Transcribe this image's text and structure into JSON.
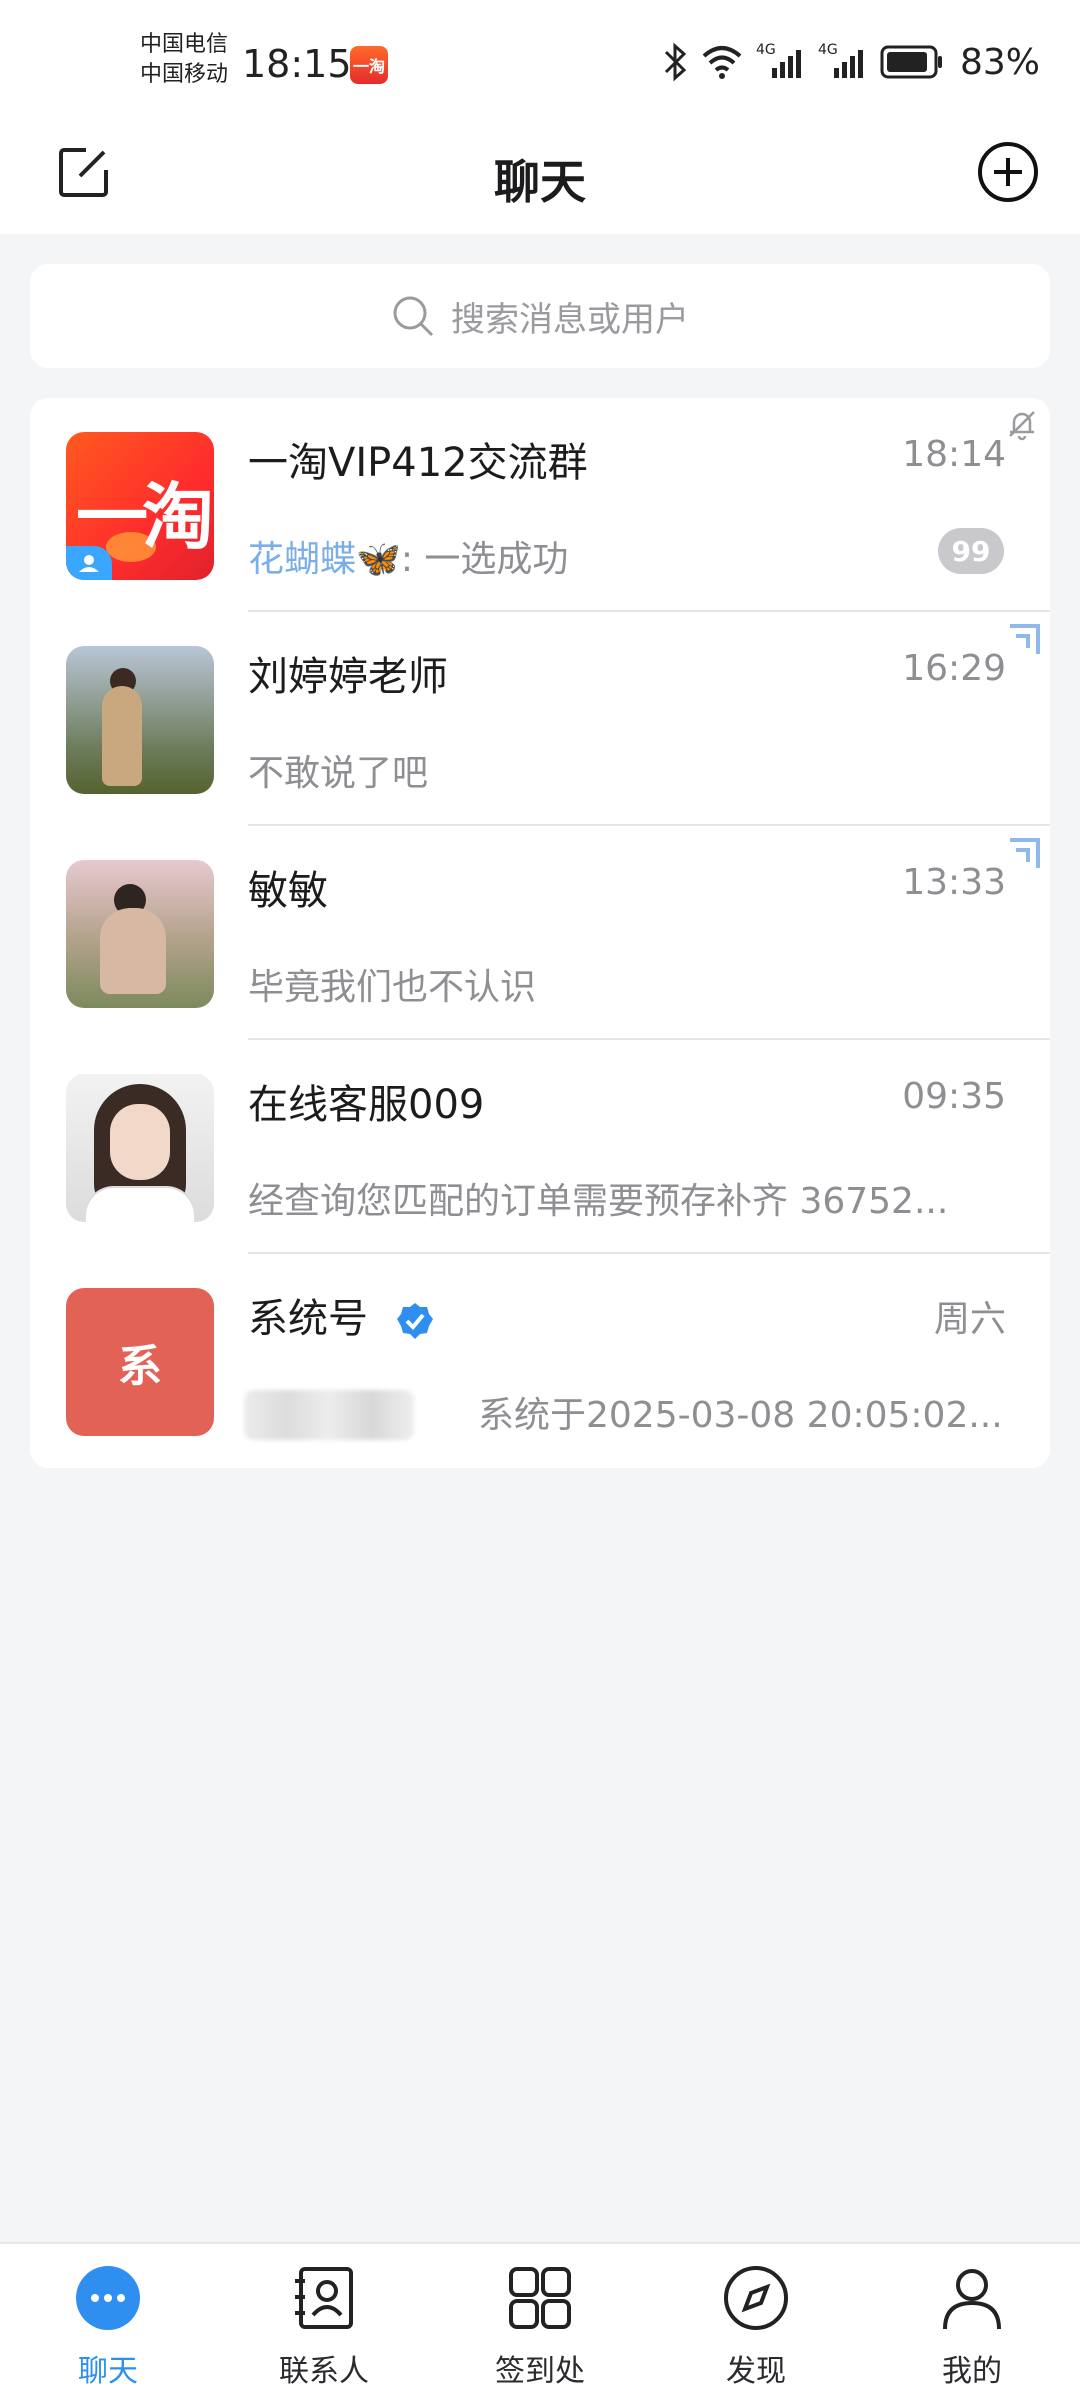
{
  "status_bar": {
    "carrier1": "中国电信",
    "carrier2": "中国移动",
    "time": "18:15",
    "network1": "4G",
    "network2": "4G",
    "battery": "83%"
  },
  "header": {
    "title": "聊天"
  },
  "search": {
    "placeholder": "搜索消息或用户"
  },
  "chats": [
    {
      "name": "一淘VIP412交流群",
      "time": "18:14",
      "sender": "花蝴蝶🦋",
      "preview": ": 一选成功",
      "unread": "99",
      "muted": true,
      "avatar_text": "一淘"
    },
    {
      "name": "刘婷婷老师",
      "time": "16:29",
      "preview": "不敢说了吧"
    },
    {
      "name": "敏敏",
      "time": "13:33",
      "preview": "毕竟我们也不认识"
    },
    {
      "name": "在线客服009",
      "time": "09:35",
      "preview": "经查询您匹配的订单需要预存补齐 36752..."
    },
    {
      "name": "系统号",
      "time": "周六",
      "preview": "系统于2025-03-08 20:05:02...",
      "avatar_text": "系",
      "verified": true
    }
  ],
  "nav": [
    {
      "label": "聊天",
      "icon": "chat-bubble-icon",
      "active": true
    },
    {
      "label": "联系人",
      "icon": "contacts-icon"
    },
    {
      "label": "签到处",
      "icon": "grid-icon"
    },
    {
      "label": "发现",
      "icon": "compass-icon"
    },
    {
      "label": "我的",
      "icon": "person-icon"
    }
  ],
  "colors": {
    "accent": "#2f8ff0",
    "sender_link": "#7aaee6",
    "system_avatar": "#e26356"
  }
}
